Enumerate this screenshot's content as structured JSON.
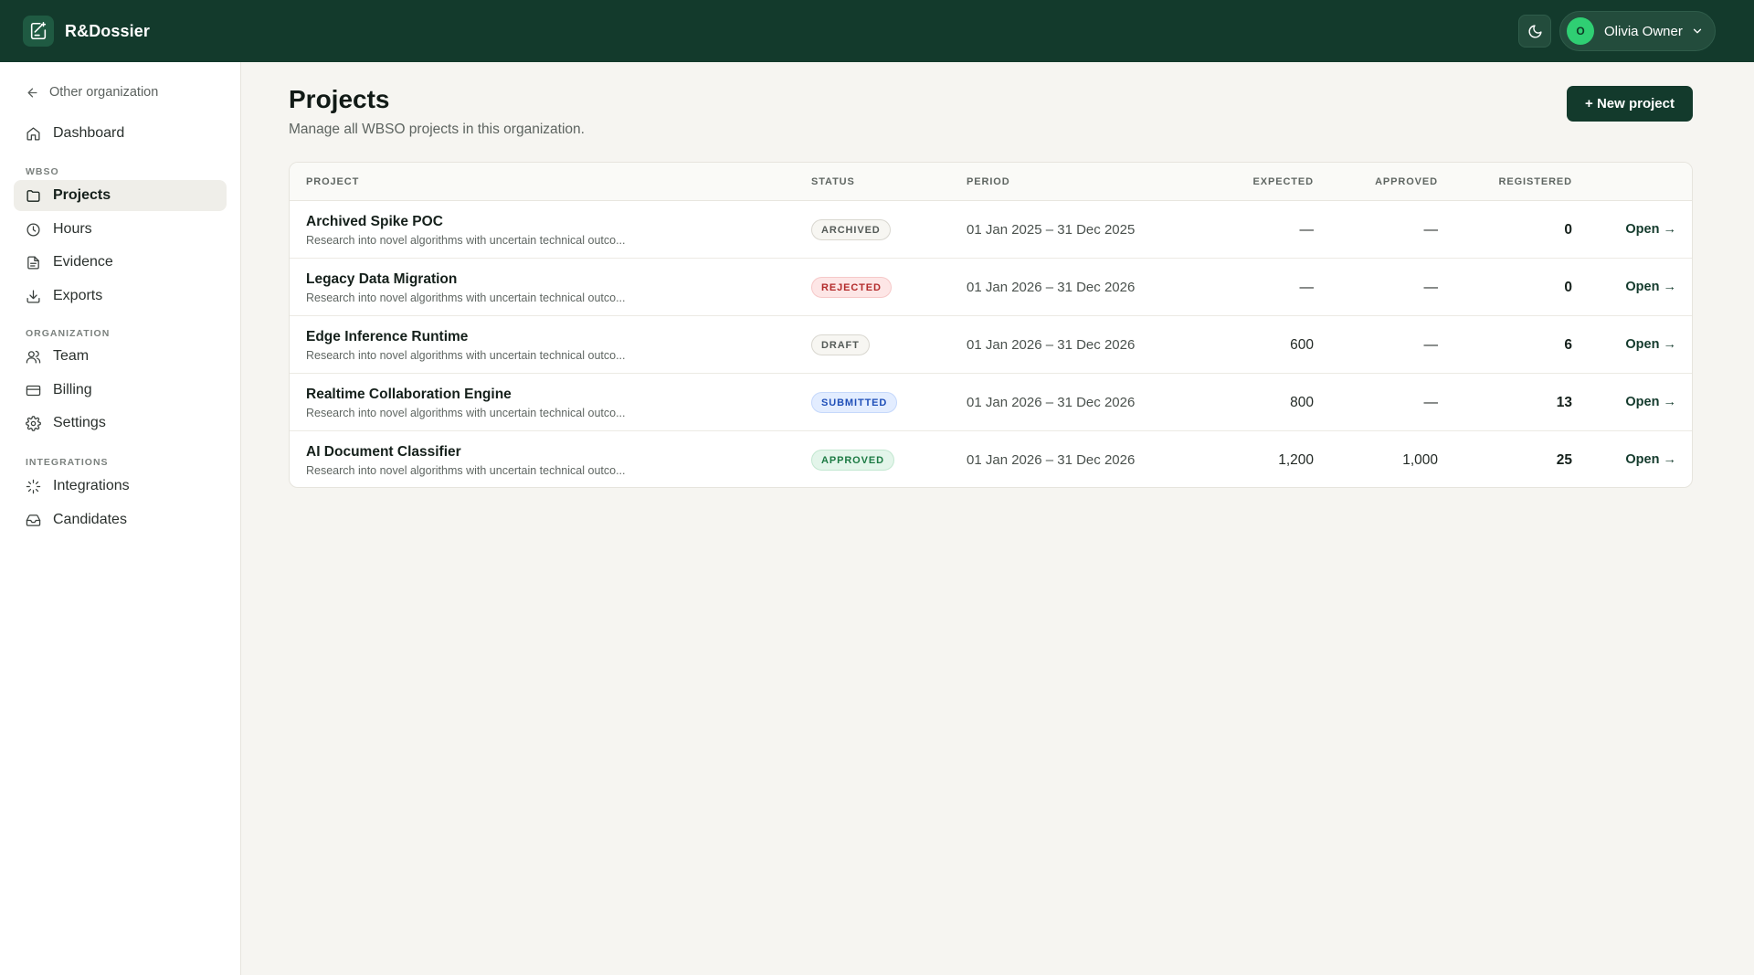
{
  "app": {
    "name": "R&Dossier"
  },
  "user": {
    "name": "Olivia Owner",
    "initial": "O"
  },
  "sidebar": {
    "back_label": "Other organization",
    "dashboard": "Dashboard",
    "section_wbso": "WBSO",
    "projects": "Projects",
    "hours": "Hours",
    "evidence": "Evidence",
    "exports": "Exports",
    "section_organization": "ORGANIZATION",
    "team": "Team",
    "billing": "Billing",
    "settings": "Settings",
    "section_integrations": "INTEGRATIONS",
    "integrations": "Integrations",
    "candidates": "Candidates"
  },
  "page": {
    "title": "Projects",
    "subtitle": "Manage all WBSO projects in this organization.",
    "new_button": "+ New project"
  },
  "table": {
    "headers": {
      "project": "PROJECT",
      "status": "STATUS",
      "period": "PERIOD",
      "expected": "EXPECTED",
      "approved": "APPROVED",
      "registered": "REGISTERED"
    },
    "open_label": "Open →",
    "rows": [
      {
        "name": "Archived Spike POC",
        "desc": "Research into novel algorithms with uncertain technical outco...",
        "status": "ARCHIVED",
        "period": "01 Jan 2025 – 31 Dec 2025",
        "expected": "—",
        "approved": "—",
        "registered": "0"
      },
      {
        "name": "Legacy Data Migration",
        "desc": "Research into novel algorithms with uncertain technical outco...",
        "status": "REJECTED",
        "period": "01 Jan 2026 – 31 Dec 2026",
        "expected": "—",
        "approved": "—",
        "registered": "0"
      },
      {
        "name": "Edge Inference Runtime",
        "desc": "Research into novel algorithms with uncertain technical outco...",
        "status": "DRAFT",
        "period": "01 Jan 2026 – 31 Dec 2026",
        "expected": "600",
        "approved": "—",
        "registered": "6"
      },
      {
        "name": "Realtime Collaboration Engine",
        "desc": "Research into novel algorithms with uncertain technical outco...",
        "status": "SUBMITTED",
        "period": "01 Jan 2026 – 31 Dec 2026",
        "expected": "800",
        "approved": "—",
        "registered": "13"
      },
      {
        "name": "AI Document Classifier",
        "desc": "Research into novel algorithms with uncertain technical outco...",
        "status": "APPROVED",
        "period": "01 Jan 2026 – 31 Dec 2026",
        "expected": "1,200",
        "approved": "1,000",
        "registered": "25"
      }
    ]
  },
  "colors": {
    "topbar": "#133a2c",
    "primary_button": "#133a2c",
    "avatar": "#2fcf73",
    "page_background": "#f6f5f1"
  },
  "icons": {
    "logo": "document-sparkle-icon",
    "theme": "moon-icon",
    "user_menu": "chevron-down-icon",
    "back": "arrow-left-icon",
    "dashboard": "home-icon",
    "projects": "folder-icon",
    "hours": "clock-icon",
    "evidence": "file-text-icon",
    "exports": "download-icon",
    "team": "users-icon",
    "billing": "credit-card-icon",
    "settings": "gear-icon",
    "integrations": "loader-icon",
    "candidates": "inbox-icon"
  }
}
